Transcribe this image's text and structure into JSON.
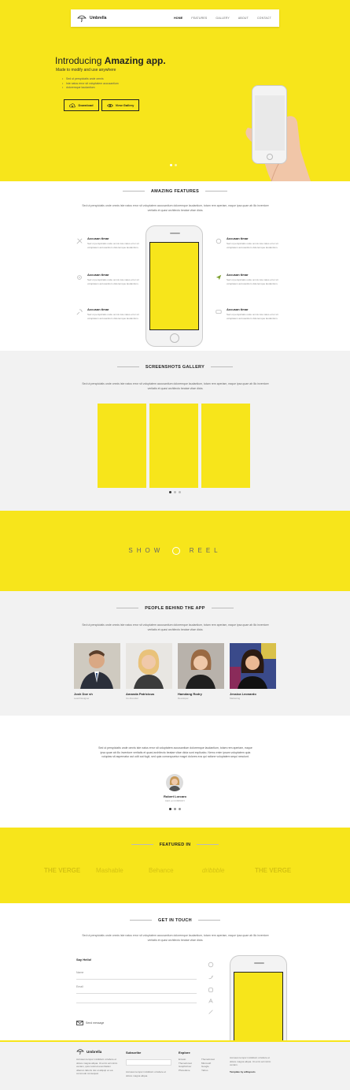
{
  "nav": {
    "brand": "Umbrella",
    "links": [
      "HOME",
      "FEATURES",
      "GALLERY",
      "ABOUT",
      "CONTACT"
    ]
  },
  "hero": {
    "title_plain": "Introducing ",
    "title_bold": "Amazing app.",
    "subtitle": "Made to modify and use anywhere",
    "bullets": [
      "Sed ut perspiciatis unde omnis",
      "Iste natus error sit voluptatem accusantium",
      "doloremque laudantium"
    ],
    "download_label": "Download",
    "gallery_label": "View Gallery"
  },
  "features": {
    "title": "AMAZING FEATURES",
    "description": "Sed ut perspiciatis unde omnis iste natus error sit voluptatem accusantium doloremque laudantium, totam rem aperiam, eaque ipsa quae ab illo inventore veritatis et quasi architecto beatae vitae dicta.",
    "items": [
      {
        "title": "Accusan timar",
        "text": "Sed ut perspiciatis unde omnis iste natus error sit voluptatem accusantium doloremque laudantium.",
        "icon": "tools-icon"
      },
      {
        "title": "Accusan timar",
        "text": "Sed ut perspiciatis unde omnis iste natus error sit voluptatem accusantium doloremque laudantium.",
        "icon": "settings-icon"
      },
      {
        "title": "Accusan timar",
        "text": "Sed ut perspiciatis unde omnis iste natus error sit voluptatem accusantium doloremque laudantium.",
        "icon": "target-icon"
      },
      {
        "title": "Accusan timar",
        "text": "Sed ut perspiciatis unde omnis iste natus error sit voluptatem accusantium doloremque laudantium.",
        "icon": "send-icon"
      },
      {
        "title": "Accusan timar",
        "text": "Sed ut perspiciatis unde omnis iste natus error sit voluptatem accusantium doloremque laudantium.",
        "icon": "search-icon"
      },
      {
        "title": "Accusan timar",
        "text": "Sed ut perspiciatis unde omnis iste natus error sit voluptatem accusantium doloremque laudantium.",
        "icon": "chat-icon"
      }
    ]
  },
  "gallery": {
    "title": "SCREENSHOTS GALLERY",
    "description": "Sed ut perspiciatis unde omnis iste natus error sit voluptatem accusantium doloremque laudantium, totam rem aperiam, eaque ipsa quae ab illo inventore veritatis et quasi architecto beatae vitae dicta."
  },
  "reel": {
    "left": "SHOW",
    "right": "REEL"
  },
  "team": {
    "title": "PEOPLE BEHIND THE APP",
    "description": "Sed ut perspiciatis unde omnis iste natus error sit voluptatem accusantium doloremque laudantium, totam rem aperiam, eaque ipsa quae ab illo inventore veritatis et quasi architecto beatae vitae dicta.",
    "members": [
      {
        "name": "Josh Doe sh",
        "role": "Lead Designer"
      },
      {
        "name": "Amanda Patricious",
        "role": "Co-Founder"
      },
      {
        "name": "Hamdang Rodry",
        "role": "Developer"
      },
      {
        "name": "Jessica Leonardo",
        "role": "Marketing"
      }
    ]
  },
  "testimonial": {
    "quote": "Sed ut perspiciatis unde omnis iste natus error sit voluptatem accusantium doloremque laudantium, totam rem aperiam, eaque ipsa quae ab illo inventore veritatis et quasi architecto beatae vitae dicta sunt explicabo. Nemo enim ipsam voluptatem quia voluptas sit aspernatur aut odit aut fugit, sed quia consequuntur magni dolores eos qui ratione voluptatem sequi nesciunt.",
    "author": "Robert Lorcaro",
    "role": "CEO at COMPANY"
  },
  "featured": {
    "title": "FEATURED IN",
    "brands": [
      "THE VERGE",
      "Mashable",
      "Behance",
      "dribbble",
      "THE VERGE"
    ]
  },
  "contact": {
    "title": "GET IN TOUCH",
    "description": "Sed ut perspiciatis unde omnis iste natus error sit voluptatem accusantium doloremque laudantium, totam rem aperiam, eaque ipsa quae ab illo inventore veritatis et quasi architecto beatae vitae dicta.",
    "form_title": "Say Hello!",
    "name_label": "Name",
    "email_label": "Email",
    "send_label": "Send message"
  },
  "footer": {
    "brand": "Umbrella",
    "about": "Accusan tempor incididunt ut labore et dolore magna aliqua. Ut enim ad minim veniam, quis nostrud exercitation ullamco laboris nisi ut aliquip ex ea commodo consequat.",
    "subscribe_title": "Subscribe",
    "subscribe_text": "Accusan tempor incididunt ut labore et dolore magna aliqua.",
    "explore_title": "Explore",
    "explore_col1": [
      "Envato",
      "Themeforest",
      "Graphicriver"
    ],
    "explore_col2": [
      "Themeforest",
      "Microsoft",
      "Google"
    ],
    "explore_extra1": "Photodune",
    "explore_extra2": "Yahoo",
    "right_text": "Accusan tempor incididunt ut labore et dolore magna aliqua. Ut enim ad minim veniam.",
    "credit": "Template by w3layouts"
  },
  "colors": {
    "accent": "#f7e51b",
    "light_bg": "#f2f2f2"
  }
}
